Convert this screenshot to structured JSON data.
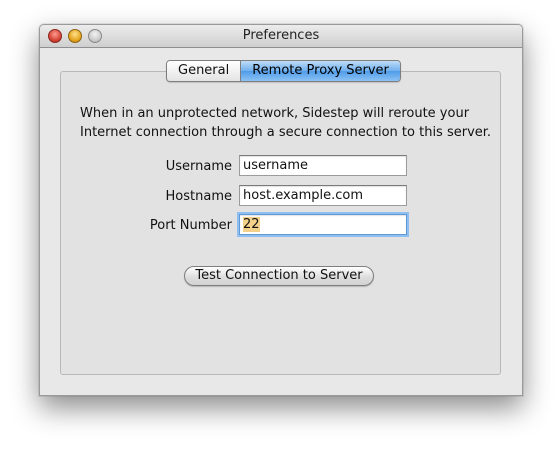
{
  "window": {
    "title": "Preferences"
  },
  "tabs": [
    {
      "label": "General",
      "selected": false
    },
    {
      "label": "Remote Proxy Server",
      "selected": true
    }
  ],
  "description": {
    "line1": "When in an unprotected network, Sidestep will reroute your",
    "line2": "Internet connection through a secure connection to this server."
  },
  "form": {
    "username_label": "Username",
    "username_value": "username",
    "hostname_label": "Hostname",
    "hostname_value": "host.example.com",
    "port_label": "Port Number",
    "port_value": "22"
  },
  "button": {
    "test_label": "Test Connection to Server"
  },
  "colors": {
    "close": "#d23f33",
    "minimize": "#e3a21b",
    "zoom_disabled": "#c9c9c9",
    "selected_tab": "#6fb0ee",
    "focus_ring": "#8fbef0",
    "text_selection": "#f4d18a"
  }
}
